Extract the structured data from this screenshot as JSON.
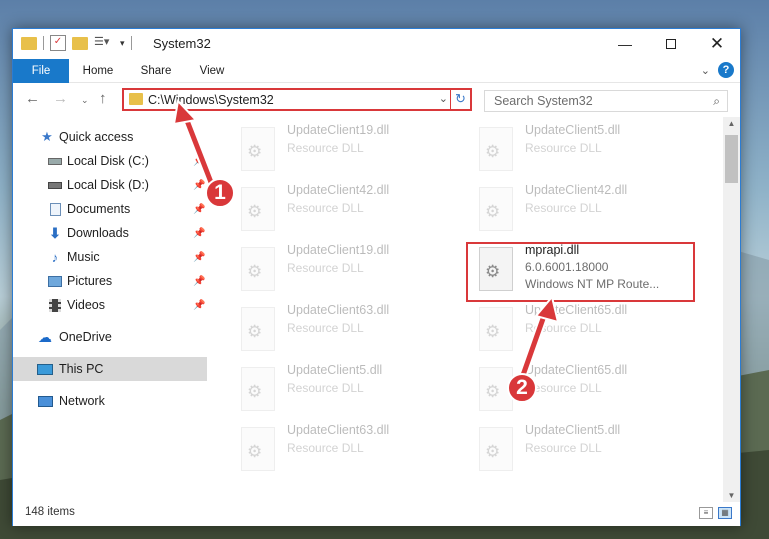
{
  "window": {
    "title": "System32",
    "tabs": [
      "File",
      "Home",
      "Share",
      "View"
    ],
    "controls": [
      "minimize-icon",
      "maximize-icon",
      "close-icon"
    ]
  },
  "navbar": {
    "address": "C:\\Windows\\System32",
    "search_placeholder": "Search System32"
  },
  "sidebar": {
    "items": [
      {
        "label": "Quick access",
        "icon": "star-icon",
        "pinned": false
      },
      {
        "label": "Local Disk (C:)",
        "icon": "drive-icon",
        "pinned": true
      },
      {
        "label": "Local Disk (D:)",
        "icon": "drive-icon",
        "pinned": true
      },
      {
        "label": "Documents",
        "icon": "documents-icon",
        "pinned": true
      },
      {
        "label": "Downloads",
        "icon": "download-icon",
        "pinned": true
      },
      {
        "label": "Music",
        "icon": "music-icon",
        "pinned": true
      },
      {
        "label": "Pictures",
        "icon": "pictures-icon",
        "pinned": true
      },
      {
        "label": "Videos",
        "icon": "videos-icon",
        "pinned": true
      },
      {
        "label": "OneDrive",
        "icon": "cloud-icon",
        "pinned": false
      },
      {
        "label": "This PC",
        "icon": "computer-icon",
        "pinned": false,
        "selected": true
      },
      {
        "label": "Network",
        "icon": "network-icon",
        "pinned": false
      }
    ]
  },
  "files": [
    {
      "name": "UpdateClient19.dll",
      "type": "Resource DLL"
    },
    {
      "name": "UpdateClient5.dll",
      "type": "Resource DLL"
    },
    {
      "name": "UpdateClient42.dll",
      "type": "Resource DLL"
    },
    {
      "name": "UpdateClient42.dll",
      "type": "Resource DLL"
    },
    {
      "name": "UpdateClient19.dll",
      "type": "Resource DLL"
    },
    {
      "name": "mprapi.dll",
      "type": "6.0.6001.18000",
      "desc": "Windows NT MP Route..."
    },
    {
      "name": "UpdateClient63.dll",
      "type": "Resource DLL"
    },
    {
      "name": "UpdateClient65.dll",
      "type": "Resource DLL"
    },
    {
      "name": "UpdateClient5.dll",
      "type": "Resource DLL"
    },
    {
      "name": "UpdateClient65.dll",
      "type": "Resource DLL"
    },
    {
      "name": "UpdateClient63.dll",
      "type": "Resource DLL"
    },
    {
      "name": "UpdateClient5.dll",
      "type": "Resource DLL"
    }
  ],
  "status": {
    "item_count": "148 items"
  },
  "annotations": {
    "badge_1": "1",
    "badge_2": "2",
    "color": "#d9383a"
  }
}
